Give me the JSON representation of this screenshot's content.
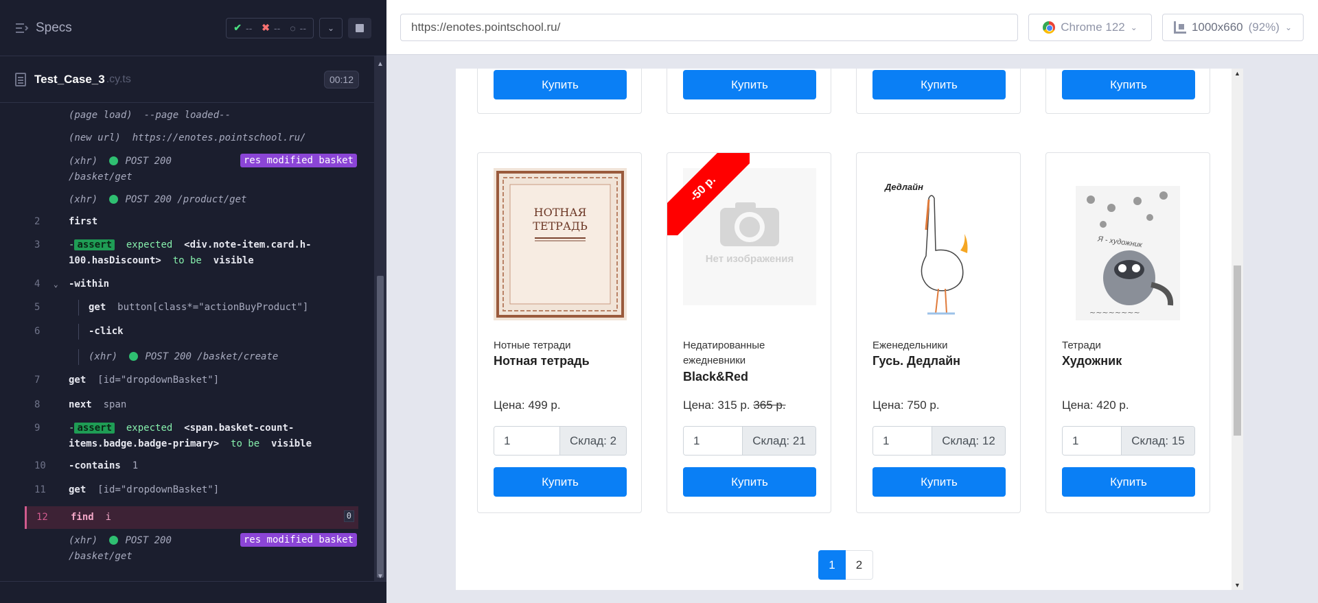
{
  "reporter": {
    "title": "Specs",
    "stats": {
      "passed": "--",
      "failed": "--",
      "pending": "--"
    },
    "spec": {
      "name": "Test_Case_3",
      "ext": ".cy.ts",
      "time": "00:12"
    },
    "commands": [
      {
        "text1": "(page load)",
        "text2": "--page loaded--"
      },
      {
        "text1": "(new url)",
        "text2": "https://enotes.pointschool.ru/"
      },
      {
        "text1": "(xhr)",
        "method": "POST 200",
        "path": "/basket/get",
        "badge": "res modified basket"
      },
      {
        "text1": "(xhr)",
        "method": "POST 200 /product/get"
      },
      {
        "num": "2",
        "name": "first"
      },
      {
        "num": "3",
        "tag": "assert",
        "expect": "expected",
        "sel": "<div.note-item.card.h-100.hasDiscount>",
        "tobe": "to be",
        "state": "visible"
      },
      {
        "num": "4",
        "name": "-within"
      },
      {
        "num": "5",
        "name": "get",
        "arg": "button[class*=\"actionBuyProduct\"]"
      },
      {
        "num": "6",
        "name": "-click"
      },
      {
        "text1": "(xhr)",
        "method": "POST 200 /basket/create"
      },
      {
        "num": "7",
        "name": "get",
        "arg": "[id=\"dropdownBasket\"]"
      },
      {
        "num": "8",
        "name": "next",
        "arg": "span"
      },
      {
        "num": "9",
        "tag": "assert",
        "expect": "expected",
        "sel": "<span.basket-count-items.badge.badge-primary>",
        "tobe": "to be",
        "state": "visible"
      },
      {
        "num": "10",
        "name": "-contains",
        "arg": "1"
      },
      {
        "num": "11",
        "name": "get",
        "arg": "[id=\"dropdownBasket\"]"
      },
      {
        "num": "12",
        "name": "find",
        "arg": "i",
        "count": "0"
      },
      {
        "text1": "(xhr)",
        "method": "POST 200",
        "path": "/basket/get",
        "badge": "res modified basket"
      }
    ]
  },
  "browser": {
    "url": "https://enotes.pointschool.ru/",
    "browser_name": "Chrome 122",
    "viewport": "1000x660",
    "zoom": "(92%)"
  },
  "shop": {
    "buy_label": "Купить",
    "no_image": "Нет изображения",
    "price_prefix": "Цена:",
    "stock_prefix": "Склад:",
    "products": [
      {
        "category": "Нотные тетради",
        "name": "Нотная тетрадь",
        "price": "Цена: 499 р.",
        "old_price": "",
        "qty": "1",
        "stock": "Склад: 2",
        "cover_title": "НОТНАЯ ТЕТРАДЬ"
      },
      {
        "category": "Недатированные ежедневники",
        "name": "Black&Red",
        "price": "Цена: 315 р.",
        "old_price": "365 р.",
        "qty": "1",
        "stock": "Склад: 21",
        "discount": "-50 р."
      },
      {
        "category": "Еженедельники",
        "name": "Гусь. Дедлайн",
        "price": "Цена: 750 р.",
        "old_price": "",
        "qty": "1",
        "stock": "Склад: 12",
        "cover_title": "Дедлайн"
      },
      {
        "category": "Тетради",
        "name": "Художник",
        "price": "Цена: 420 р.",
        "old_price": "",
        "qty": "1",
        "stock": "Склад: 15",
        "cover_title": "Я - художник"
      }
    ],
    "pages": [
      "1",
      "2"
    ]
  },
  "colors": {
    "primary": "#0a7ff5",
    "discount": "#ff0000",
    "reporter_bg": "#1b1e2e",
    "assert": "#1f9d55",
    "badge": "#8b45d6"
  }
}
